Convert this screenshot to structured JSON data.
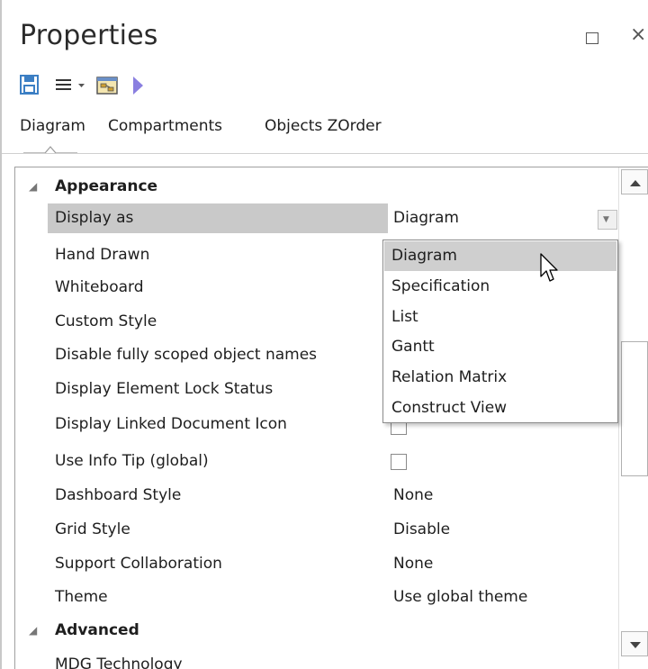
{
  "window": {
    "title": "Properties"
  },
  "toolbar": {
    "icons": [
      "save-icon",
      "menu-icon",
      "dropdown-arrow-icon",
      "diagram-properties-icon",
      "play-icon"
    ]
  },
  "tabs": [
    "Diagram",
    "Compartments",
    "Objects ZOrder"
  ],
  "categories": {
    "appearance": "Appearance",
    "advanced": "Advanced"
  },
  "properties": [
    {
      "name": "Display as",
      "value": "Diagram"
    },
    {
      "name": "Hand Drawn",
      "value": ""
    },
    {
      "name": "Whiteboard",
      "value": ""
    },
    {
      "name": "Custom Style",
      "value": ""
    },
    {
      "name": "Disable fully scoped object names",
      "value": ""
    },
    {
      "name": "Display Element Lock Status",
      "value": ""
    },
    {
      "name": "Display Linked Document Icon",
      "value": ""
    },
    {
      "name": "Use Info Tip (global)",
      "value": ""
    },
    {
      "name": "Dashboard Style",
      "value": "None"
    },
    {
      "name": "Grid Style",
      "value": "Disable"
    },
    {
      "name": "Support Collaboration",
      "value": "None"
    },
    {
      "name": "Theme",
      "value": "Use global theme"
    }
  ],
  "advanced_properties": [
    {
      "name": "MDG Technology",
      "value": ""
    }
  ],
  "dropdown": {
    "options": [
      "Diagram",
      "Specification",
      "List",
      "Gantt",
      "Relation Matrix",
      "Construct View"
    ],
    "highlighted": "Diagram"
  },
  "colors": {
    "selected_row": "#c9c9c9",
    "highlight_option": "#cfcfcf",
    "save_icon": "#3c7fc4",
    "play_icon": "#8a7fe0"
  }
}
